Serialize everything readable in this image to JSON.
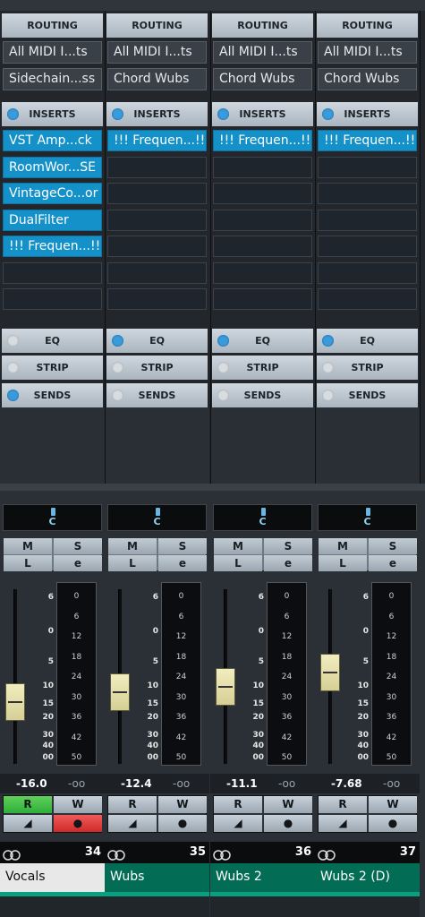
{
  "sections": {
    "routing": "ROUTING",
    "inserts": "INSERTS",
    "eq": "EQ",
    "strip": "STRIP",
    "sends": "SENDS"
  },
  "channels": [
    {
      "routing_in": "All MIDI I...ts",
      "routing_out": "Sidechain...ss",
      "inserts": [
        "VST Amp...ck",
        "RoomWor...SE",
        "VintageCo...or",
        "DualFilter",
        "!!! Frequen...!!",
        "",
        ""
      ],
      "eq_on": false,
      "strip_on": false,
      "sends_on": true,
      "pan": "C",
      "volume": "-16.0",
      "peak": "-oo",
      "r_active": true,
      "w_active": true,
      "number": "34",
      "name": "Vocals",
      "name_bg": "#e8e8e8",
      "name_color": "#111111"
    },
    {
      "routing_in": "All MIDI I...ts",
      "routing_out": "Chord Wubs",
      "inserts": [
        "!!! Frequen...!!",
        "",
        "",
        "",
        "",
        "",
        ""
      ],
      "eq_on": true,
      "strip_on": false,
      "sends_on": false,
      "pan": "C",
      "volume": "-12.4",
      "peak": "-oo",
      "r_active": false,
      "w_active": false,
      "number": "35",
      "name": "Wubs",
      "name_bg": "#026c55",
      "name_color": "#ffffff"
    },
    {
      "routing_in": "All MIDI I...ts",
      "routing_out": "Chord Wubs",
      "inserts": [
        "!!! Frequen...!!",
        "",
        "",
        "",
        "",
        "",
        ""
      ],
      "eq_on": true,
      "strip_on": false,
      "sends_on": false,
      "pan": "C",
      "volume": "-11.1",
      "peak": "-oo",
      "r_active": false,
      "w_active": false,
      "number": "36",
      "name": "Wubs 2",
      "name_bg": "#026c55",
      "name_color": "#ffffff"
    },
    {
      "routing_in": "All MIDI I...ts",
      "routing_out": "Chord Wubs",
      "inserts": [
        "!!! Frequen...!!",
        "",
        "",
        "",
        "",
        "",
        ""
      ],
      "eq_on": true,
      "strip_on": false,
      "sends_on": false,
      "pan": "C",
      "volume": "-7.68",
      "peak": "-oo",
      "r_active": false,
      "w_active": false,
      "number": "37",
      "name": "Wubs 2 (D)",
      "name_bg": "#026c55",
      "name_color": "#ffffff"
    }
  ],
  "buttons": {
    "mute": "M",
    "solo": "S",
    "listen": "L",
    "edit": "e",
    "read": "R",
    "write": "W"
  },
  "fader_scale": [
    "6",
    "0",
    "5",
    "10",
    "15",
    "20",
    "30",
    "40",
    "00"
  ],
  "meter_scale": [
    "0",
    "6",
    "12",
    "18",
    "24",
    "30",
    "36",
    "42",
    "50"
  ],
  "colors": {
    "insert_active": "#1591c9",
    "name_strip": "#026c55",
    "write_active": "#e03a3a",
    "read_active": "#2fae3a",
    "fader_knob": "#e8e2b0"
  }
}
